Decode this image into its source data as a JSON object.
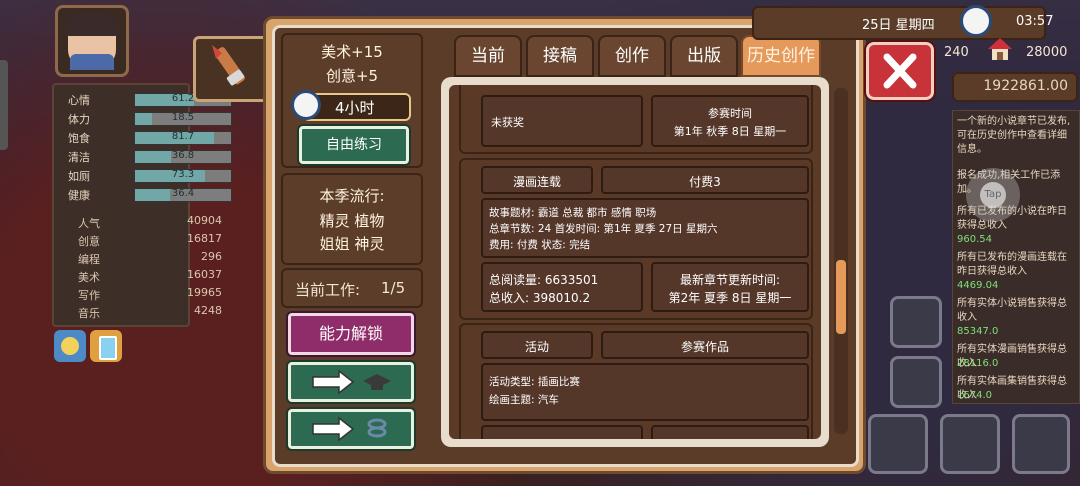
{
  "stats": {
    "bars": [
      {
        "label": "心情",
        "value": "61.2",
        "pct": 61
      },
      {
        "label": "体力",
        "value": "18.5",
        "pct": 18
      },
      {
        "label": "饱食",
        "value": "81.7",
        "pct": 82
      },
      {
        "label": "清洁",
        "value": "36.8",
        "pct": 37
      },
      {
        "label": "如厕",
        "value": "73.3",
        "pct": 73
      },
      {
        "label": "健康",
        "value": "36.4",
        "pct": 36
      }
    ],
    "numbers": [
      {
        "label": "人气",
        "value": "40904"
      },
      {
        "label": "创意",
        "value": "16817"
      },
      {
        "label": "编程",
        "value": "296"
      },
      {
        "label": "美术",
        "value": "16037"
      },
      {
        "label": "写作",
        "value": "19965"
      },
      {
        "label": "音乐",
        "value": "4248"
      }
    ]
  },
  "practice": {
    "gain1": "美术+15",
    "gain2": "创意+5",
    "time": "4小时",
    "button": "自由练习"
  },
  "trend": {
    "title": "本季流行:",
    "line1": "精灵  植物",
    "line2": "姐姐  神灵"
  },
  "work": {
    "label": "当前工作:",
    "value": "1/5"
  },
  "unlock_button": "能力解锁",
  "tabs": [
    "当前",
    "接稿",
    "创作",
    "出版",
    "历史创作"
  ],
  "history": {
    "card0": {
      "status": "未获奖",
      "time_label": "参赛时间",
      "time_value": "第1年  秋季  8日   星期一"
    },
    "card1": {
      "type": "漫画连载",
      "pay": "付费3",
      "line1": "故事题材:   霸道  总裁  都市  感情  职场",
      "line2": "总章节数:   24     首发时间:   第1年  夏季  27日   星期六",
      "line3": "费用:  付费     状态:   完结",
      "reads": "总阅读量:   6633501",
      "income": "总收入:   398010.2",
      "update_label": "最新章节更新时间:",
      "update_value": "第2年  夏季  8日   星期一"
    },
    "card2": {
      "type": "活动",
      "entry": "参赛作品",
      "line1": "活动类型:   插画比赛",
      "line2": "绘画主题:     汽车"
    }
  },
  "top": {
    "date": "25日   星期四",
    "time": "03:57",
    "n1": "240",
    "n2": "28000",
    "money": "1922861.00"
  },
  "log": [
    "一个新的小说章节已发布,可在历史创作中查看详细信息。",
    "报名成功,相关工作已添加。",
    "所有已发布的小说在昨日获得总收入",
    "960.54",
    "所有已发布的漫画连载在昨日获得总收入",
    "4469.04",
    "所有实体小说销售获得总收入",
    "85347.0",
    "所有实体漫画销售获得总收入",
    "28116.0",
    "所有实体画集销售获得总收入",
    "1674.0"
  ],
  "tap_label": "Tap",
  "colors": {
    "accent": "#e59a5c",
    "green_btn": "#2c6a52",
    "pink_btn": "#8f2c6a",
    "close": "#c8333a"
  }
}
